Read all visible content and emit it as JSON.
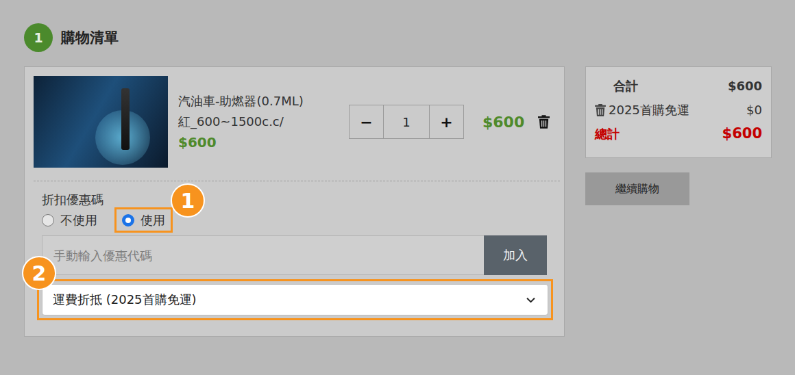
{
  "section": {
    "step": "1",
    "title": "購物清單"
  },
  "cart": {
    "items": [
      {
        "name": "汽油車-助燃器(0.7ML)",
        "variant": "紅_600~1500c.c/",
        "unit_price": "$600",
        "quantity": "1",
        "decrease": "−",
        "increase": "+",
        "subtotal": "$600"
      }
    ]
  },
  "discount": {
    "label": "折扣優惠碼",
    "options": [
      {
        "label": "不使用",
        "selected": false
      },
      {
        "label": "使用",
        "selected": true
      }
    ],
    "code_input": {
      "placeholder": "手動輸入優惠代碼"
    },
    "apply_button": "加入",
    "coupon_select": {
      "value": "運費折抵 (2025首購免運)"
    }
  },
  "annotations": {
    "radio": "1",
    "select": "2"
  },
  "summary": {
    "rows": [
      {
        "label": "合計",
        "value": "$600",
        "kind": "subtotal"
      },
      {
        "label": "2025首購免運",
        "value": "$0",
        "kind": "coupon"
      },
      {
        "label": "總計",
        "value": "$600",
        "kind": "total"
      }
    ]
  },
  "continue_button": "繼續購物"
}
